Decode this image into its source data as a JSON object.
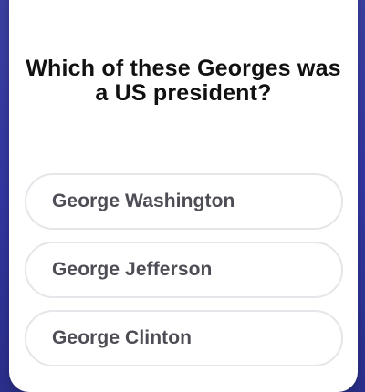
{
  "quiz": {
    "question": "Which of these Georges was a US president?",
    "options": [
      {
        "label": "George Washington"
      },
      {
        "label": "George Jefferson"
      },
      {
        "label": "George Clinton"
      }
    ]
  },
  "colors": {
    "background": "#2f3590",
    "card": "#ffffff",
    "question_text": "#111111",
    "option_text": "#4d4d55",
    "option_border": "#e5e5ea"
  }
}
